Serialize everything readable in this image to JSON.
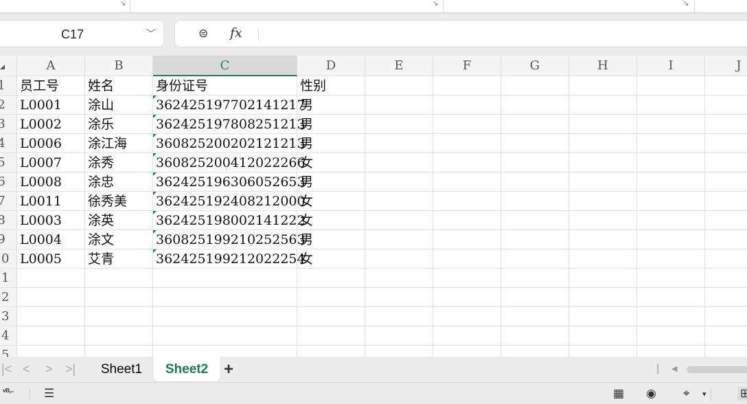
{
  "name_box": {
    "value": "C17"
  },
  "formula_bar": {
    "value": ""
  },
  "columns": [
    "A",
    "B",
    "C",
    "D",
    "E",
    "F",
    "G",
    "H",
    "I",
    "J"
  ],
  "selected_column": "C",
  "rows": [
    [
      "员工号",
      "姓名",
      "身份证号",
      "性别"
    ],
    [
      "L0001",
      "涂山",
      "362425197702141217",
      "男"
    ],
    [
      "L0002",
      "涂乐",
      "362425197808251213",
      "男"
    ],
    [
      "L0006",
      "涂江海",
      "360825200202121213",
      "男"
    ],
    [
      "L0007",
      "涂秀",
      "360825200412022266",
      "女"
    ],
    [
      "L0008",
      "涂忠",
      "362425196306052653",
      "男"
    ],
    [
      "L0011",
      "徐秀美",
      "362425192408212000",
      "女"
    ],
    [
      "L0003",
      "涂英",
      "362425198002141222",
      "女"
    ],
    [
      "L0004",
      "涂文",
      "360825199210252563",
      "男"
    ],
    [
      "L0005",
      "艾青",
      "362425199212022254",
      "女"
    ]
  ],
  "row_count": 15,
  "sheets": [
    {
      "label": "Sheet1",
      "active": false
    },
    {
      "label": "Sheet2",
      "active": true
    }
  ],
  "status_icons": [
    "vba-icon",
    "sidebar-list-icon",
    "table-settings-icon",
    "eye-icon",
    "move-icon",
    "grid-view-icon"
  ]
}
